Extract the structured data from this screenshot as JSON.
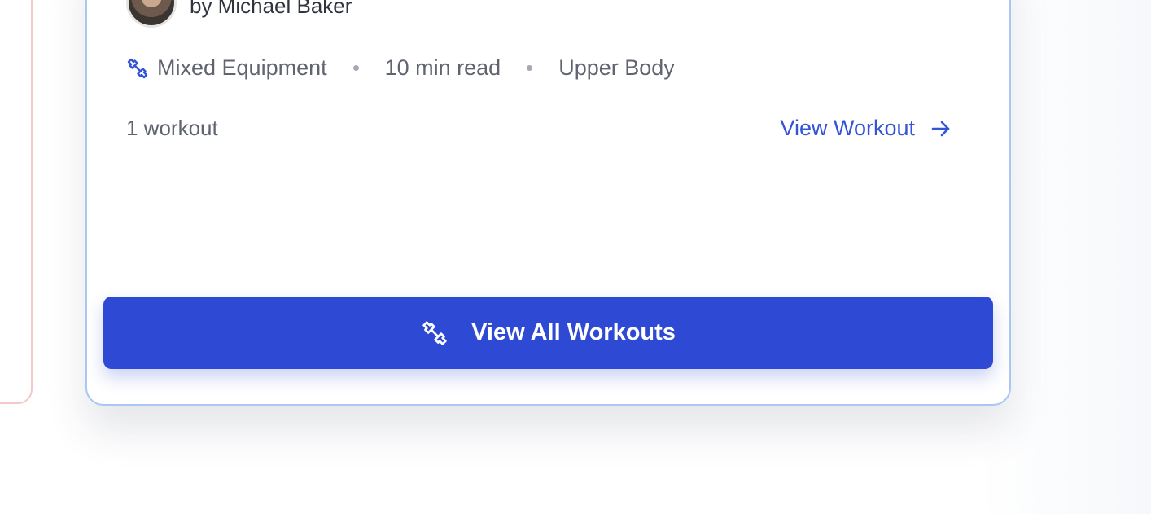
{
  "author": {
    "name": "by Michael Baker"
  },
  "meta": {
    "equipment": "Mixed Equipment",
    "read_time": "10 min read",
    "body_part": "Upper Body"
  },
  "footer": {
    "count": "1 workout",
    "view_link": "View Workout"
  },
  "cta": {
    "label": "View All Workouts"
  },
  "icons": {
    "equipment": "dumbbell-icon",
    "link": "arrow-right-icon",
    "cta": "dumbbell-icon"
  },
  "colors": {
    "accent": "#2e4ad4",
    "link": "#3454d6",
    "card_border": "#a9c7f2",
    "side_card_border": "#f3c9c9"
  }
}
